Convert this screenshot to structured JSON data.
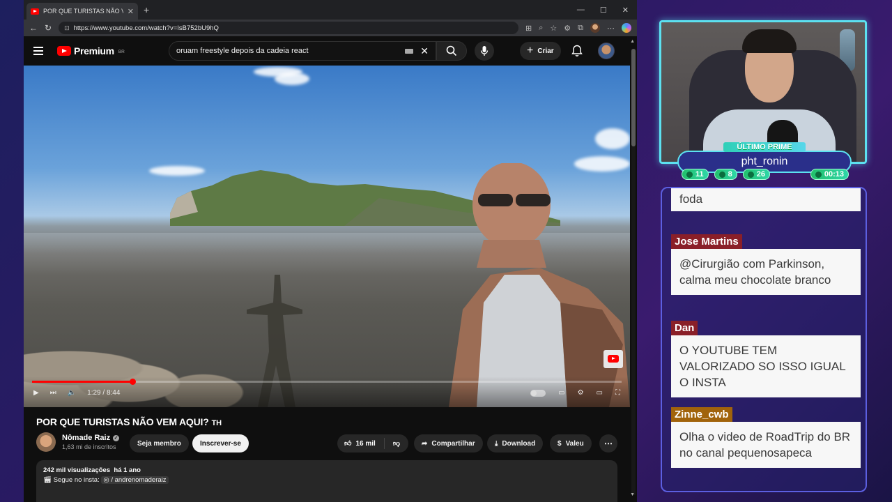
{
  "browser": {
    "tab_title": "POR QUE TURISTAS NÃO VEM AQ",
    "url": "https://www.youtube.com/watch?v=IsB752bU9hQ"
  },
  "youtube": {
    "logo_text": "Premium",
    "country": "BR",
    "search_query": "oruam freestyle depois da cadeia react",
    "create_label": "Criar"
  },
  "player": {
    "time": "1:29 / 8:44",
    "progress_fraction": 0.17
  },
  "video": {
    "title": "POR QUE TURISTAS NÃO VEM AQUI?",
    "title_suffix": "TH",
    "channel_name": "Nômade Raiz",
    "subscribers": "1,63 mi de inscritos",
    "member_label": "Seja membro",
    "subscribe_label": "Inscrever-se",
    "likes": "16 mil",
    "share_label": "Compartilhar",
    "download_label": "Download",
    "thanks_label": "Valeu",
    "views": "242 mil visualizações",
    "age": "há 1 ano",
    "insta_prefix": "Segue no insta:",
    "insta_handle": "/ andrenomaderaiz"
  },
  "stream": {
    "badge_title": "ÚLTIMO PRIME",
    "badge_user": "pht_ronin",
    "stats": [
      "11",
      "8",
      "26"
    ],
    "timer": "00:13"
  },
  "chat": [
    {
      "author": "",
      "text": "foda"
    },
    {
      "author": "Jose Martins",
      "text": "@Cirurgião com Parkinson, calma meu chocolate branco",
      "color": "#8a1f28"
    },
    {
      "author": "Dan",
      "text": "O YOUTUBE TEM VALORIZADO SO ISSO IGUAL O INSTA",
      "color": "#8a1f28"
    },
    {
      "author": "Zinne_cwb",
      "text": "Olha o video de RoadTrip do BR no canal pequenosapeca",
      "color": "#a1630b"
    }
  ]
}
